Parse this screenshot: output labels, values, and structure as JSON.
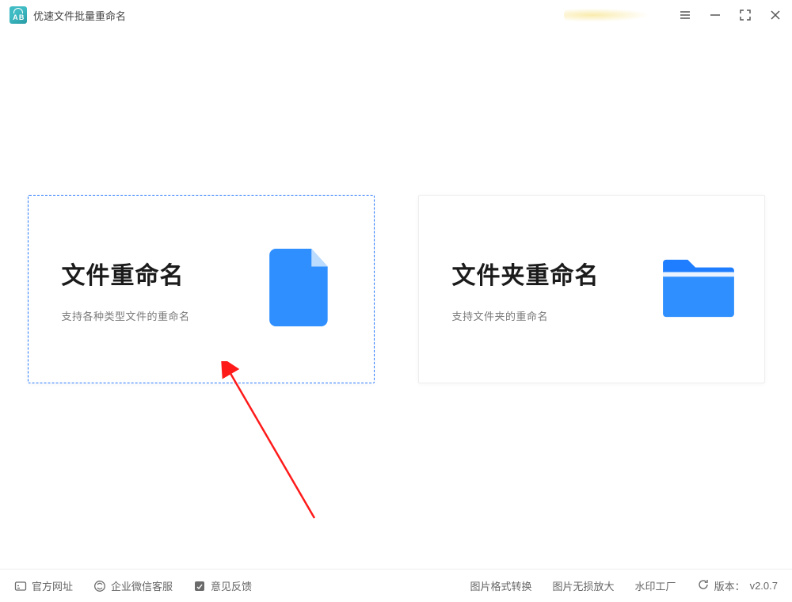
{
  "header": {
    "app_title": "优速文件批量重命名"
  },
  "cards": {
    "file_rename": {
      "title": "文件重命名",
      "subtitle": "支持各种类型文件的重命名"
    },
    "folder_rename": {
      "title": "文件夹重命名",
      "subtitle": "支持文件夹的重命名"
    }
  },
  "footer": {
    "official_site": "官方网址",
    "wechat_support": "企业微信客服",
    "feedback": "意见反馈",
    "link_img_convert": "图片格式转换",
    "link_img_upscale": "图片无损放大",
    "link_watermark": "水印工厂",
    "version_label": "版本：",
    "version_value": "v2.0.7"
  }
}
